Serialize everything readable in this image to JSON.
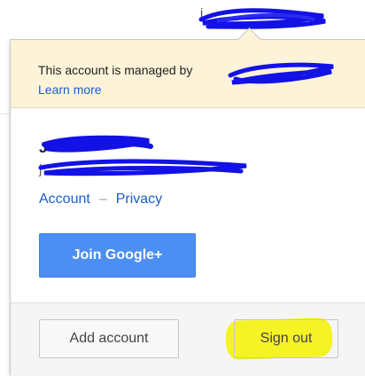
{
  "topbar": {
    "email_redacted": "j"
  },
  "notice": {
    "text": "This account is managed by",
    "link": "Learn more"
  },
  "profile": {
    "name_visible": "J",
    "email_visible": "j",
    "links": [
      "Account",
      "Privacy"
    ],
    "separator": "–"
  },
  "join_button": "Join Google+",
  "footer": {
    "add_account": "Add account",
    "sign_out": "Sign out"
  },
  "colors": {
    "notice_bg": "#fcf3d8",
    "link_blue": "#1a5ec9",
    "button_blue": "#4d8ef2",
    "highlight_yellow": "#f4f11a",
    "redaction_blue": "#1212e6"
  }
}
